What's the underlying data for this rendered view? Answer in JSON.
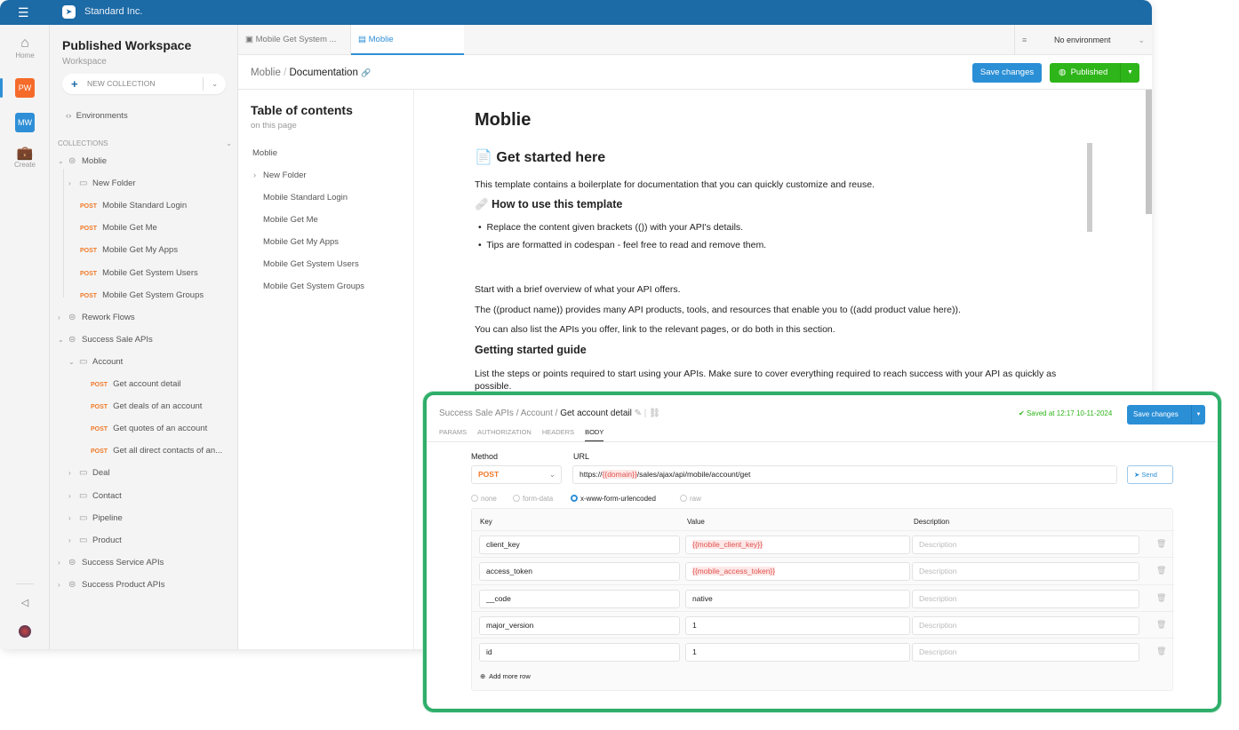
{
  "app": {
    "brand": "Standard Inc.",
    "menu_icon": "hamburger-icon",
    "logo_icon": "paper-plane-icon"
  },
  "rail": {
    "home": "Home",
    "workspaces": [
      {
        "initials": "PW",
        "color": "#f56b2a"
      },
      {
        "initials": "MW",
        "color": "#2f8fd6"
      }
    ],
    "create": "Create"
  },
  "sidebar": {
    "title": "Published Workspace",
    "subtitle": "Workspace",
    "new_collection": "NEW COLLECTION",
    "environments": "Environments",
    "collections_header": "COLLECTIONS",
    "tree": [
      {
        "type": "collection",
        "label": "Moblie",
        "expanded": true,
        "level": 0
      },
      {
        "type": "folder",
        "label": "New Folder",
        "expanded": false,
        "level": 1
      },
      {
        "type": "request",
        "method": "POST",
        "label": "Mobile Standard Login",
        "level": 1
      },
      {
        "type": "request",
        "method": "POST",
        "label": "Mobile Get Me",
        "level": 1
      },
      {
        "type": "request",
        "method": "POST",
        "label": "Mobile Get My Apps",
        "level": 1
      },
      {
        "type": "request",
        "method": "POST",
        "label": "Mobile Get System Users",
        "level": 1
      },
      {
        "type": "request",
        "method": "POST",
        "label": "Mobile Get System Groups",
        "level": 1
      },
      {
        "type": "collection",
        "label": "Rework Flows",
        "expanded": false,
        "level": 0
      },
      {
        "type": "collection",
        "label": "Success Sale APIs",
        "expanded": true,
        "level": 0
      },
      {
        "type": "folder",
        "label": "Account",
        "expanded": true,
        "level": 1
      },
      {
        "type": "request",
        "method": "POST",
        "label": "Get account detail",
        "level": 2
      },
      {
        "type": "request",
        "method": "POST",
        "label": "Get deals of an account",
        "level": 2
      },
      {
        "type": "request",
        "method": "POST",
        "label": "Get quotes of an account",
        "level": 2
      },
      {
        "type": "request",
        "method": "POST",
        "label": "Get all direct contacts of an...",
        "level": 2
      },
      {
        "type": "folder",
        "label": "Deal",
        "expanded": false,
        "level": 1
      },
      {
        "type": "folder",
        "label": "Contact",
        "expanded": false,
        "level": 1
      },
      {
        "type": "folder",
        "label": "Pipeline",
        "expanded": false,
        "level": 1
      },
      {
        "type": "folder",
        "label": "Product",
        "expanded": false,
        "level": 1
      },
      {
        "type": "collection",
        "label": "Success Service APIs",
        "expanded": false,
        "level": 0
      },
      {
        "type": "collection",
        "label": "Success Product APIs",
        "expanded": false,
        "level": 0
      }
    ]
  },
  "tabs": [
    {
      "label": "Mobile Get System ...",
      "active": false
    },
    {
      "label": "Moblie",
      "active": true
    }
  ],
  "environment": "No environment",
  "breadcrumb": {
    "parent": "Moblie",
    "current": "Documentation"
  },
  "actions": {
    "save": "Save changes",
    "publish": "Published",
    "save_color": "#2b8fd6",
    "publish_color": "#2eb519"
  },
  "toc": {
    "title": "Table of contents",
    "subtitle": "on this page",
    "items": [
      "Moblie",
      "New Folder",
      "Mobile Standard Login",
      "Mobile Get Me",
      "Mobile Get My Apps",
      "Mobile Get System Users",
      "Mobile Get System Groups"
    ]
  },
  "doc": {
    "title": "Moblie",
    "h_get_started": "Get started here",
    "p1": "This template contains a boilerplate for documentation that you can quickly customize and reuse.",
    "h_how": "How to use this template",
    "bullets": [
      "Replace the content given brackets (()) with your API's details.",
      "Tips are formatted in codespan - feel free to read and remove them."
    ],
    "p2": "Start with a brief overview of what your API offers.",
    "p3": "The ((product name)) provides many API products, tools, and resources that enable you to ((add product value here)).",
    "p4": "You can also list the APIs you offer, link to the relevant pages, or do both in this section.",
    "h_guide": "Getting started guide",
    "p5": "List the steps or points required to start using your APIs. Make sure to cover everything required to reach success with your API as quickly as possible."
  },
  "request": {
    "breadcrumb": [
      "Success Sale APIs",
      "Account",
      "Get account detail"
    ],
    "saved": "Saved at 12:17 10-11-2024",
    "save": "Save changes",
    "tabs": [
      "PARAMS",
      "AUTHORIZATION",
      "HEADERS",
      "BODY"
    ],
    "active_tab": "BODY",
    "method_label": "Method",
    "method": "POST",
    "url_label": "URL",
    "url_prefix": "https://",
    "url_var": "{{domain}}",
    "url_suffix": "/sales/ajax/api/mobile/account/get",
    "send": "Send",
    "body_types": [
      "none",
      "form-data",
      "x-www-form-urlencoded",
      "raw"
    ],
    "body_type": "x-www-form-urlencoded",
    "columns": [
      "Key",
      "Value",
      "Description"
    ],
    "rows": [
      {
        "key": "client_key",
        "value": "{{mobile_client_key}}",
        "is_var": true,
        "description": ""
      },
      {
        "key": "access_token",
        "value": "{{mobile_access_token}}",
        "is_var": true,
        "description": ""
      },
      {
        "key": "__code",
        "value": "native",
        "is_var": false,
        "description": ""
      },
      {
        "key": "major_version",
        "value": "1",
        "is_var": false,
        "description": ""
      },
      {
        "key": "id",
        "value": "1",
        "is_var": false,
        "description": ""
      }
    ],
    "description_placeholder": "Description",
    "add_row": "Add more row"
  }
}
